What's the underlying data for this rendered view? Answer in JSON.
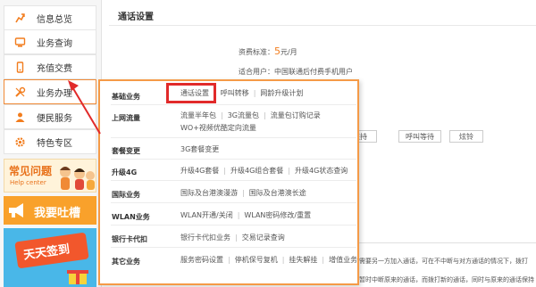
{
  "sidebar": {
    "items": [
      {
        "label": "信息总览",
        "icon": "chart-icon"
      },
      {
        "label": "业务查询",
        "icon": "monitor-icon"
      },
      {
        "label": "充值交费",
        "icon": "phone-icon"
      },
      {
        "label": "业务办理",
        "icon": "wrench-icon"
      },
      {
        "label": "便民服务",
        "icon": "person-icon"
      },
      {
        "label": "特色专区",
        "icon": "gear-icon"
      }
    ],
    "promos": {
      "faq_title": "常见问题",
      "faq_sub": "Help center",
      "complaint": "我要吐槽",
      "signin": "天天签到"
    }
  },
  "main": {
    "title": "通话设置",
    "fee_label": "资费标准：",
    "fee_value": "5",
    "fee_unit": "元/月",
    "users_label": "适合用户：",
    "users_value": "中国联通后付费手机用户",
    "buttons": [
      "保持",
      "呼叫等待",
      "炫铃"
    ],
    "bg_text_1": "如需要另一方加入通话，可在不中断与对方通话的情况下，拨打",
    "bg_text_2": "以暂时中断原来的通话，而拨打新的通话，同时与原来的通话保持"
  },
  "dropdown": {
    "categories": [
      {
        "name": "基础业务",
        "links": [
          "通话设置",
          "呼叫转移",
          "网龄升级计划"
        ]
      },
      {
        "name": "上网流量",
        "links": [
          "流量半年包",
          "3G流量包",
          "流量包订购记录"
        ],
        "links2": [
          "WO+视频优酷定向流量"
        ]
      },
      {
        "name": "套餐变更",
        "links": [
          "3G套餐变更"
        ]
      },
      {
        "name": "升级4G",
        "links": [
          "升级4G套餐",
          "升级4G组合套餐",
          "升级4G状态查询"
        ]
      },
      {
        "name": "国际业务",
        "links": [
          "国际及台港澳漫游",
          "国际及台港澳长途"
        ]
      },
      {
        "name": "WLAN业务",
        "links": [
          "WLAN开通/关闭",
          "WLAN密码修改/重置"
        ]
      },
      {
        "name": "银行卡代扣",
        "links": [
          "银行卡代扣业务",
          "交易记录查询"
        ]
      },
      {
        "name": "其它业务",
        "links": [
          "服务密码设置",
          "停机保号复机",
          "挂失解挂",
          "增值业务"
        ]
      }
    ]
  },
  "colors": {
    "accent": "#f27d1e",
    "highlight": "#e12a2a",
    "border": "#f59a47"
  }
}
